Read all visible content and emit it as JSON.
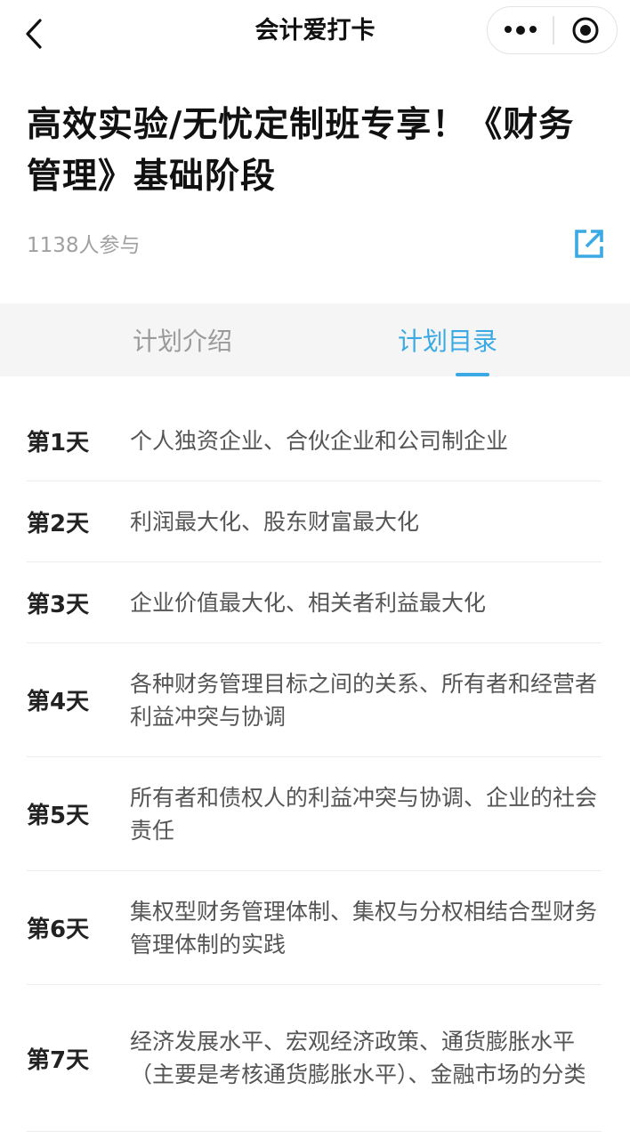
{
  "nav": {
    "title": "会计爱打卡",
    "back_icon": "chevron-left-icon",
    "more_icon": "more-dots-icon",
    "close_icon": "target-close-icon"
  },
  "plan": {
    "title": "高效实验/无忧定制班专享！《财务管理》基础阶段",
    "participants": "1138人参与",
    "share_icon": "share-external-icon"
  },
  "tabs": [
    {
      "label": "计划介绍",
      "active": false
    },
    {
      "label": "计划目录",
      "active": true
    }
  ],
  "catalog": [
    {
      "day": "第1天",
      "content": "个人独资企业、合伙企业和公司制企业"
    },
    {
      "day": "第2天",
      "content": "利润最大化、股东财富最大化"
    },
    {
      "day": "第3天",
      "content": "企业价值最大化、相关者利益最大化"
    },
    {
      "day": "第4天",
      "content": "各种财务管理目标之间的关系、所有者和经营者利益冲突与协调"
    },
    {
      "day": "第5天",
      "content": "所有者和债权人的利益冲突与协调、企业的社会责任"
    },
    {
      "day": "第6天",
      "content": "集权型财务管理体制、集权与分权相结合型财务管理体制的实践"
    },
    {
      "day": "第7天",
      "content": "经济发展水平、宏观经济政策、通货膨胀水平（主要是考核通货膨胀水平）、金融市场的分类"
    }
  ],
  "colors": {
    "accent": "#3aa9e4",
    "tab_bg": "#f5f5f5",
    "muted": "#a0a0a0"
  }
}
